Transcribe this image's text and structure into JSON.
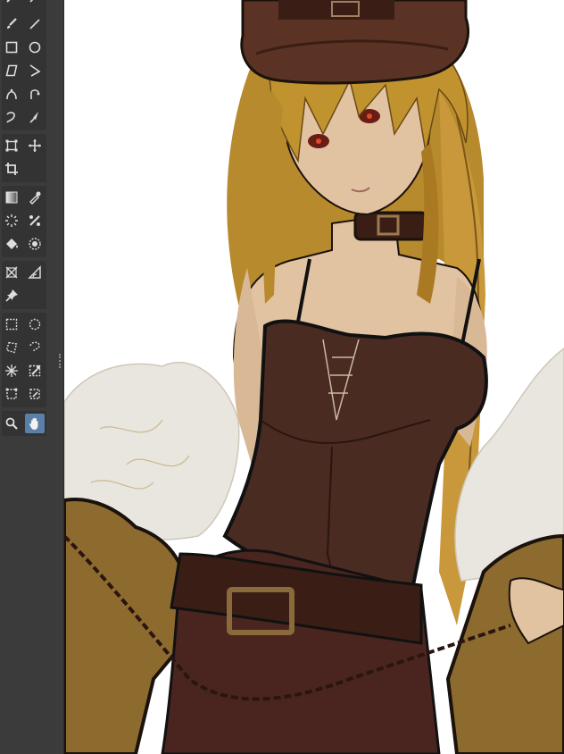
{
  "app": {
    "panel": "Toolbar",
    "active_tool": "Hand"
  },
  "toolbar": {
    "tools": [
      [
        "paintbrush-icon",
        "line-icon"
      ],
      [
        "rectangle-icon",
        "ellipse-icon"
      ],
      [
        "polygon-icon",
        "polyline-icon"
      ],
      [
        "bezier-curve-icon",
        "bezier-tool-icon"
      ],
      [
        "freehand-lasso-curve-icon",
        "smudge-icon"
      ],
      [
        "transform-icon",
        "move-icon"
      ],
      [
        "crop-icon"
      ],
      [
        "gradient-icon",
        "color-picker-icon"
      ],
      [
        "smart-patch-icon",
        "assistant-icon"
      ],
      [
        "fill-bucket-icon",
        "enclose-fill-icon"
      ],
      [
        "perspective-icon",
        "measure-icon"
      ],
      [
        "reference-pin-icon"
      ],
      [
        "rect-select-icon",
        "ellipse-select-icon"
      ],
      [
        "polygon-select-icon",
        "freehand-select-icon"
      ],
      [
        "magic-wand-select-icon",
        "similar-color-select-icon"
      ],
      [
        "bezier-select-icon",
        "magnetic-select-icon"
      ],
      [
        "zoom-icon",
        "hand-icon"
      ]
    ]
  },
  "colors": {
    "toolbar_bg": "#3b3b3b",
    "group_bg": "#333333",
    "active": "#5a7fa8",
    "hair": "#c1932f",
    "dress": "#4a2b22",
    "belt": "#3a1e16",
    "skin": "#e1c2a1",
    "fur": "#e9e6df",
    "jacket": "#8d6a2e"
  }
}
